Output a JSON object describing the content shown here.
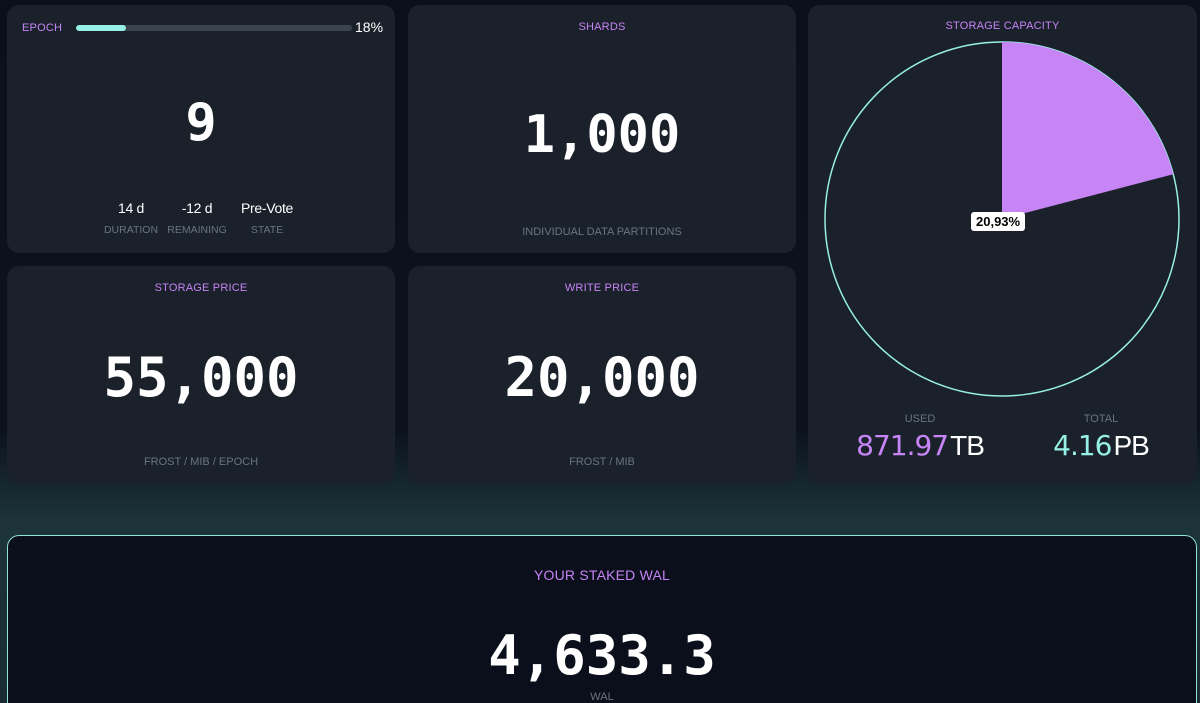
{
  "epoch": {
    "title": "EPOCH",
    "progress_percent": 18,
    "progress_label": "18%",
    "value": "9",
    "stats": [
      {
        "value": "14 d",
        "label": "DURATION"
      },
      {
        "value": "-12 d",
        "label": "REMAINING"
      },
      {
        "value": "Pre-Vote",
        "label": "STATE"
      }
    ]
  },
  "shards": {
    "title": "SHARDS",
    "value": "1,000",
    "caption": "INDIVIDUAL DATA PARTITIONS"
  },
  "storage_price": {
    "title": "STORAGE PRICE",
    "value": "55,000",
    "caption": "FROST / MIB / EPOCH"
  },
  "write_price": {
    "title": "WRITE PRICE",
    "value": "20,000",
    "caption": "FROST / MIB"
  },
  "capacity": {
    "title": "STORAGE CAPACITY",
    "used_percent": 20.93,
    "used_percent_label": "20,93%",
    "used_label": "USED",
    "used_value": "871.97",
    "used_unit": "TB",
    "total_label": "TOTAL",
    "total_value": "4.16",
    "total_unit": "PB",
    "colors": {
      "used": "#c684f5",
      "ring": "#97f0e5",
      "fill": "#1a212b"
    }
  },
  "staked": {
    "title": "YOUR STAKED WAL",
    "value": "4,633.3",
    "unit": "WAL"
  }
}
